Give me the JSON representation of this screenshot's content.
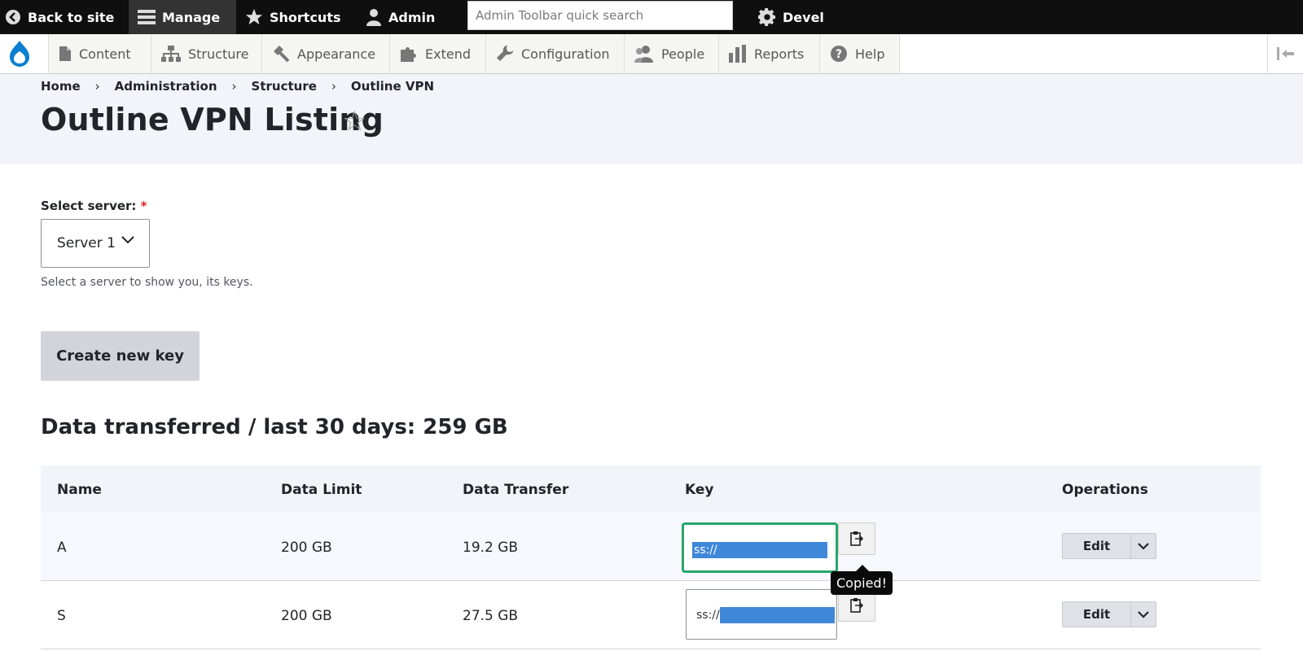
{
  "toolbar": {
    "back_to_site": "Back to site",
    "manage": "Manage",
    "shortcuts": "Shortcuts",
    "admin": "Admin",
    "search_placeholder": "Admin Toolbar quick search",
    "devel": "Devel"
  },
  "tray": {
    "items": [
      {
        "label": "Content",
        "icon": "file-icon"
      },
      {
        "label": "Structure",
        "icon": "sitemap-icon"
      },
      {
        "label": "Appearance",
        "icon": "paintbrush-icon"
      },
      {
        "label": "Extend",
        "icon": "puzzle-icon"
      },
      {
        "label": "Configuration",
        "icon": "wrench-icon"
      },
      {
        "label": "People",
        "icon": "people-icon"
      },
      {
        "label": "Reports",
        "icon": "bar-chart-icon"
      },
      {
        "label": "Help",
        "icon": "help-icon"
      }
    ]
  },
  "breadcrumb": [
    "Home",
    "Administration",
    "Structure",
    "Outline VPN"
  ],
  "page": {
    "title": "Outline VPN Listing",
    "select_label": "Select server:",
    "required_mark": "*",
    "select_value": "Server 1",
    "select_help": "Select a server to show you, its keys.",
    "create_button": "Create new key",
    "data_heading": "Data transferred / last 30 days: 259 GB"
  },
  "table": {
    "headers": [
      "Name",
      "Data Limit",
      "Data Transfer",
      "Key",
      "Operations"
    ],
    "rows": [
      {
        "name": "A",
        "limit": "200 GB",
        "transfer": "19.2 GB",
        "key": "ss://",
        "edit": "Edit"
      },
      {
        "name": "S",
        "limit": "200 GB",
        "transfer": "27.5 GB",
        "key": "ss://",
        "edit": "Edit"
      }
    ],
    "tooltip": "Copied!"
  },
  "colors": {
    "toolbar_bg": "#0f0f0f",
    "header_bg": "#f3f4f9",
    "focus_green": "#26a769",
    "selection_blue": "#3f87d9",
    "required_red": "#dc2323"
  }
}
